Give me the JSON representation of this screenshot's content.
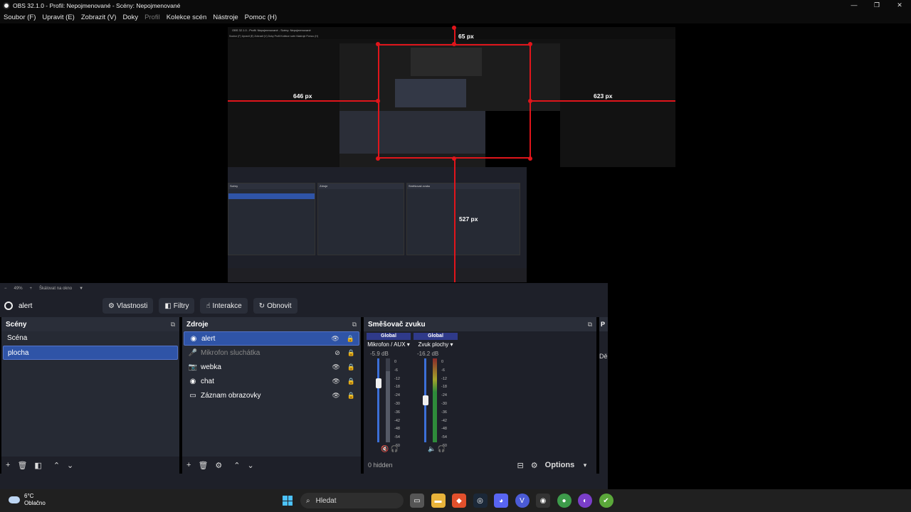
{
  "window": {
    "title": "OBS 32.1.0 - Profil: Nepojmenované - Scény: Nepojmenované",
    "controls": [
      "—",
      "❐",
      "✕"
    ]
  },
  "menu": {
    "items": [
      "Soubor (F)",
      "Upravit (E)",
      "Zobrazit (V)",
      "Doky",
      "Profil",
      "Kolekce scén",
      "Nástroje",
      "Pomoc (H)"
    ]
  },
  "preview": {
    "guide_top": "65 px",
    "guide_left": "646 px",
    "guide_right": "623 px",
    "guide_bottom": "527 px",
    "nested_title": "OBS 32.1.0 - Profil: Nepojmenované - Scény: Nepojmenované",
    "nested_menu": "Soubor (F)   Upravit (E)   Zobrazit (V)   Doky   Profil   Kolekce scén   Nástroje   Pomoc (H)"
  },
  "zoom": {
    "minus": "−",
    "level": "49%",
    "plus": "+",
    "scale_mode": "Škálovat na okno"
  },
  "context": {
    "source_name": "alert",
    "buttons": [
      "Vlastnosti",
      "Filtry",
      "Interakce",
      "Obnovit"
    ]
  },
  "scenes": {
    "title": "Scény",
    "items": [
      "Scéna",
      "plocha"
    ],
    "selected": "plocha"
  },
  "sources": {
    "title": "Zdroje",
    "items": [
      {
        "name": "alert",
        "icon": "browser-icon",
        "selected": true
      },
      {
        "name": "Mikrofon sluchátka",
        "icon": "microphone-icon",
        "muted": true
      },
      {
        "name": "webka",
        "icon": "camera-icon"
      },
      {
        "name": "chat",
        "icon": "browser-icon"
      },
      {
        "name": "Záznam obrazovky",
        "icon": "monitor-icon"
      }
    ]
  },
  "mixer": {
    "title": "Směšovač zvuku",
    "channels": [
      {
        "global": "Global",
        "name": "Mikrofon / AUX",
        "db": "-5.9 dB",
        "level": 0.85
      },
      {
        "global": "Global",
        "name": "Zvuk plochy",
        "db": "-16.2 dB",
        "level": 0.72
      }
    ],
    "scale": [
      "0",
      "-6",
      "-12",
      "-18",
      "-24",
      "-30",
      "-36",
      "-42",
      "-48",
      "-54",
      "-60"
    ],
    "hidden": "0 hidden",
    "options": "Options"
  },
  "partial_dock": {
    "title": "P",
    "text": "Dě"
  },
  "taskbar": {
    "temp": "6°C",
    "weather": "Oblačno",
    "search": "Hledat"
  },
  "colors": {
    "accent": "#2f54a7",
    "guide": "#e0151b",
    "panel": "#1e2029"
  }
}
